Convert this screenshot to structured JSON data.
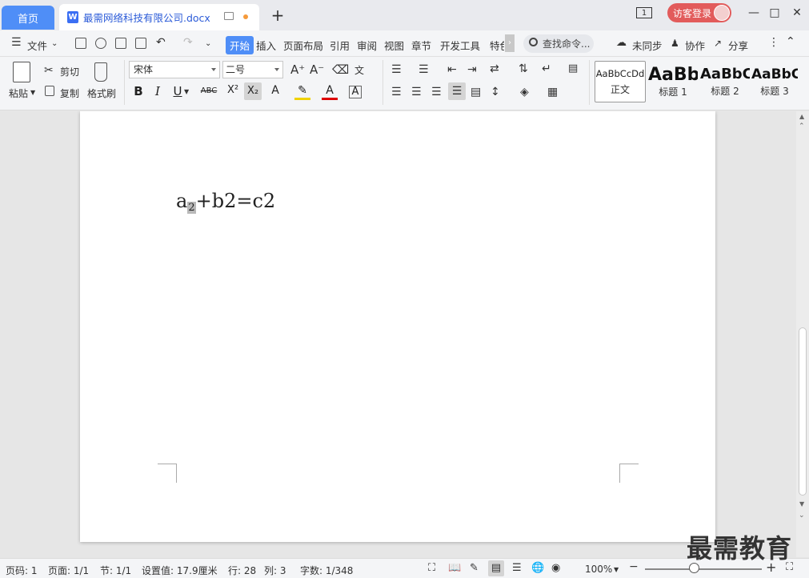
{
  "titlebar": {
    "home_tab": "首页",
    "doc_icon": "W",
    "doc_title": "最需网络科技有限公司.docx",
    "window_badge": "1",
    "login_label": "访客登录"
  },
  "menu": {
    "file": "文件",
    "tabs": [
      "开始",
      "插入",
      "页面布局",
      "引用",
      "审阅",
      "视图",
      "章节",
      "开发工具",
      "特色"
    ],
    "search_placeholder": "查找命令...",
    "sync": "未同步",
    "collab": "协作",
    "share": "分享"
  },
  "ribbon": {
    "paste": "粘贴",
    "cut": "剪切",
    "copy": "复制",
    "format_painter": "格式刷",
    "font_name": "宋体",
    "font_size": "二号",
    "bold": "B",
    "italic": "I",
    "underline": "U",
    "strikethrough": "ABC",
    "superscript": "X²",
    "subscript": "X₂",
    "styles": [
      {
        "sample": "AaBbCcDd",
        "name": "正文"
      },
      {
        "sample": "AaBb",
        "name": "标题 1"
      },
      {
        "sample": "AaBbC",
        "name": "标题 2"
      },
      {
        "sample": "AaBbC",
        "name": "标题 3"
      }
    ]
  },
  "document": {
    "text_a": "a",
    "text_sub": "2",
    "text_rest": "+b2=c2"
  },
  "status": {
    "page_no": "页码: 1",
    "pages": "页面: 1/1",
    "section": "节: 1/1",
    "setting": "设置值: 17.9厘米",
    "row": "行: 28",
    "col": "列: 3",
    "word_count": "字数: 1/348",
    "zoom": "100%",
    "zoom_level_percent": 42
  },
  "watermark": "最需教育"
}
